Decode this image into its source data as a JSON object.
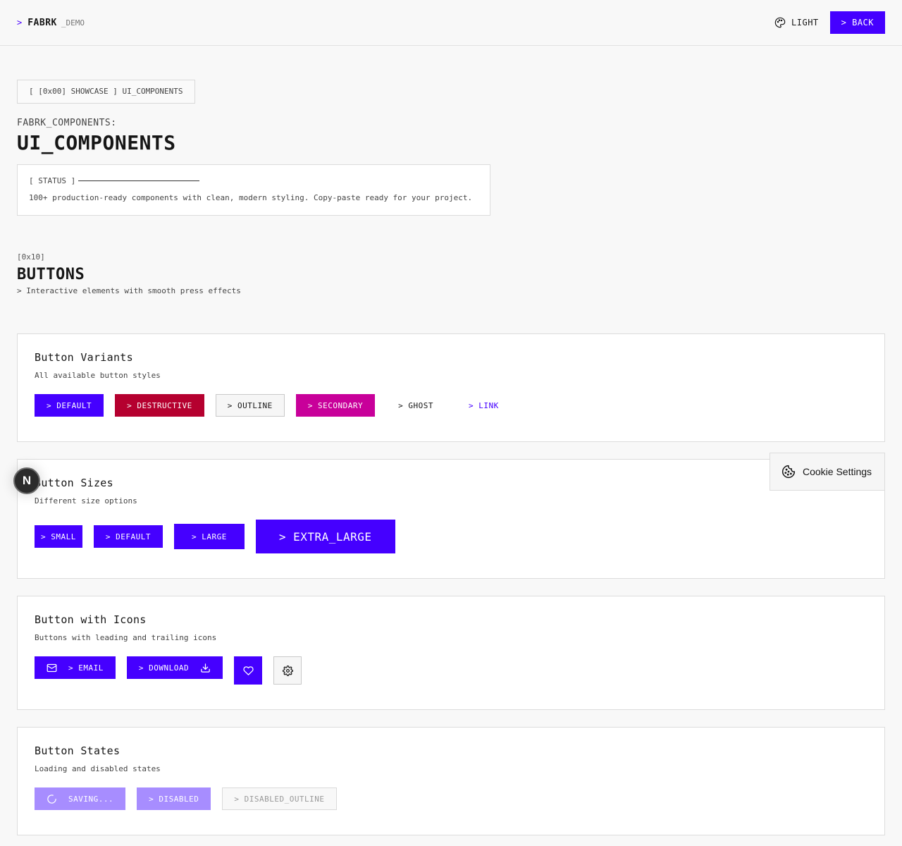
{
  "header": {
    "logo_caret": ">",
    "logo_brand": "FABRK",
    "logo_suffix": "_DEMO",
    "theme_label": "LIGHT",
    "back_label": "> BACK"
  },
  "hero": {
    "badge": "[ [0x00] SHOWCASE ] UI_COMPONENTS",
    "kicker": "FABRK_COMPONENTS:",
    "title": "UI_COMPONENTS",
    "status_head": "[ STATUS ]",
    "status_text": "100+ production-ready components with clean, modern styling. Copy-paste ready for your project."
  },
  "section": {
    "code": "[0x10]",
    "title": "BUTTONS",
    "desc": "> Interactive elements with smooth press effects"
  },
  "variants": {
    "title": "Button Variants",
    "desc": "All available button styles",
    "default": "> DEFAULT",
    "destructive": "> DESTRUCTIVE",
    "outline": "> OUTLINE",
    "secondary": "> SECONDARY",
    "ghost": "> GHOST",
    "link": "> LINK"
  },
  "sizes": {
    "title": "Button Sizes",
    "desc": "Different size options",
    "small": "> SMALL",
    "default": "> DEFAULT",
    "large": "> LARGE",
    "xl": "> EXTRA_LARGE"
  },
  "icons": {
    "title": "Button with Icons",
    "desc": "Buttons with leading and trailing icons",
    "email": "> EMAIL",
    "download": "> DOWNLOAD"
  },
  "states": {
    "title": "Button States",
    "desc": "Loading and disabled states",
    "saving": "SAVING...",
    "disabled": "> DISABLED",
    "disabled_outline": "> DISABLED_OUTLINE"
  },
  "overlay": {
    "n_badge": "N",
    "cookie": "Cookie Settings"
  },
  "colors": {
    "accent": "#4500ff",
    "destructive": "#b5002f",
    "secondary": "#c8009a"
  }
}
